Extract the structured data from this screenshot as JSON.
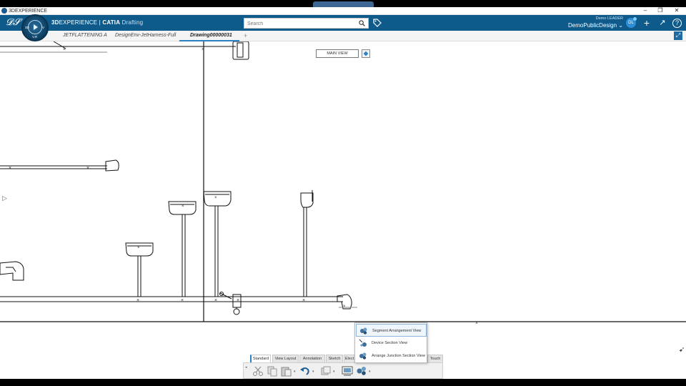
{
  "window": {
    "title": "3DEXPERIENCE",
    "minimize": "–",
    "restore": "❐",
    "close": "✕"
  },
  "header": {
    "brand_bold": "3D",
    "brand_rest": "EXPERIENCE | ",
    "brand_product": "CATIA",
    "brand_app": "Drafting",
    "search_placeholder": "Search",
    "user_name": "Demo LEADER",
    "collab_space": "DemoPublicDesign",
    "avatar_initials": "DL",
    "add_icon": "+",
    "share_icon": "↗",
    "help_icon": "?"
  },
  "compass": {
    "label_3d": "3D",
    "label_v": "V",
    "label_vr": "V,R"
  },
  "tabs": [
    {
      "label": "JETFLATTENING A"
    },
    {
      "label": "DesignEnv-JetHarness-Full"
    },
    {
      "label": "Drawing00000031"
    }
  ],
  "tab_add": "+",
  "canvas": {
    "main_view_label": "MAIN VIEW"
  },
  "popup": {
    "items": [
      {
        "label": "Segment Arrangement View",
        "icon": "segment-arrangement-icon"
      },
      {
        "label": "Device Section View",
        "icon": "device-section-icon"
      },
      {
        "label": "Arrange Junction Section View",
        "icon": "junction-section-icon"
      }
    ]
  },
  "actionbar": {
    "tabs": [
      "Standard",
      "View Layout",
      "Annotation",
      "Sketch",
      "Elect",
      "Touch"
    ],
    "tools": [
      "cut-icon",
      "copy-icon",
      "paste-icon",
      "undo-icon",
      "view-layout-icon",
      "segment-view-icon",
      "views-icon"
    ]
  },
  "colors": {
    "header_blue": "#0e5a8a",
    "accent": "#2a81c4"
  }
}
